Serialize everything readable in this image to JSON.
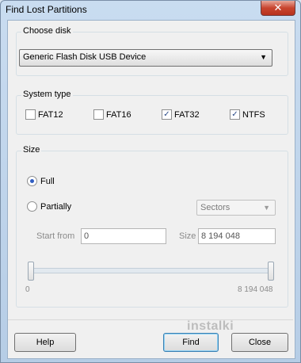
{
  "window": {
    "title": "Find Lost Partitions",
    "close_label": "✕"
  },
  "choose_disk": {
    "label": "Choose disk",
    "selected": "Generic Flash Disk USB Device"
  },
  "system_type": {
    "label": "System type",
    "options": [
      {
        "label": "FAT12",
        "checked": false
      },
      {
        "label": "FAT16",
        "checked": false
      },
      {
        "label": "FAT32",
        "checked": true
      },
      {
        "label": "NTFS",
        "checked": true
      }
    ]
  },
  "size": {
    "label": "Size",
    "full_label": "Full",
    "partially_label": "Partially",
    "selected": "Full",
    "unit_selected": "Sectors",
    "start_from_label": "Start from",
    "start_from_value": "0",
    "size_label": "Size",
    "size_value": "8 194 048",
    "slider_min": "0",
    "slider_max": "8 194 048"
  },
  "buttons": {
    "help": "Help",
    "find": "Find",
    "close": "Close"
  },
  "watermark": "instalki"
}
